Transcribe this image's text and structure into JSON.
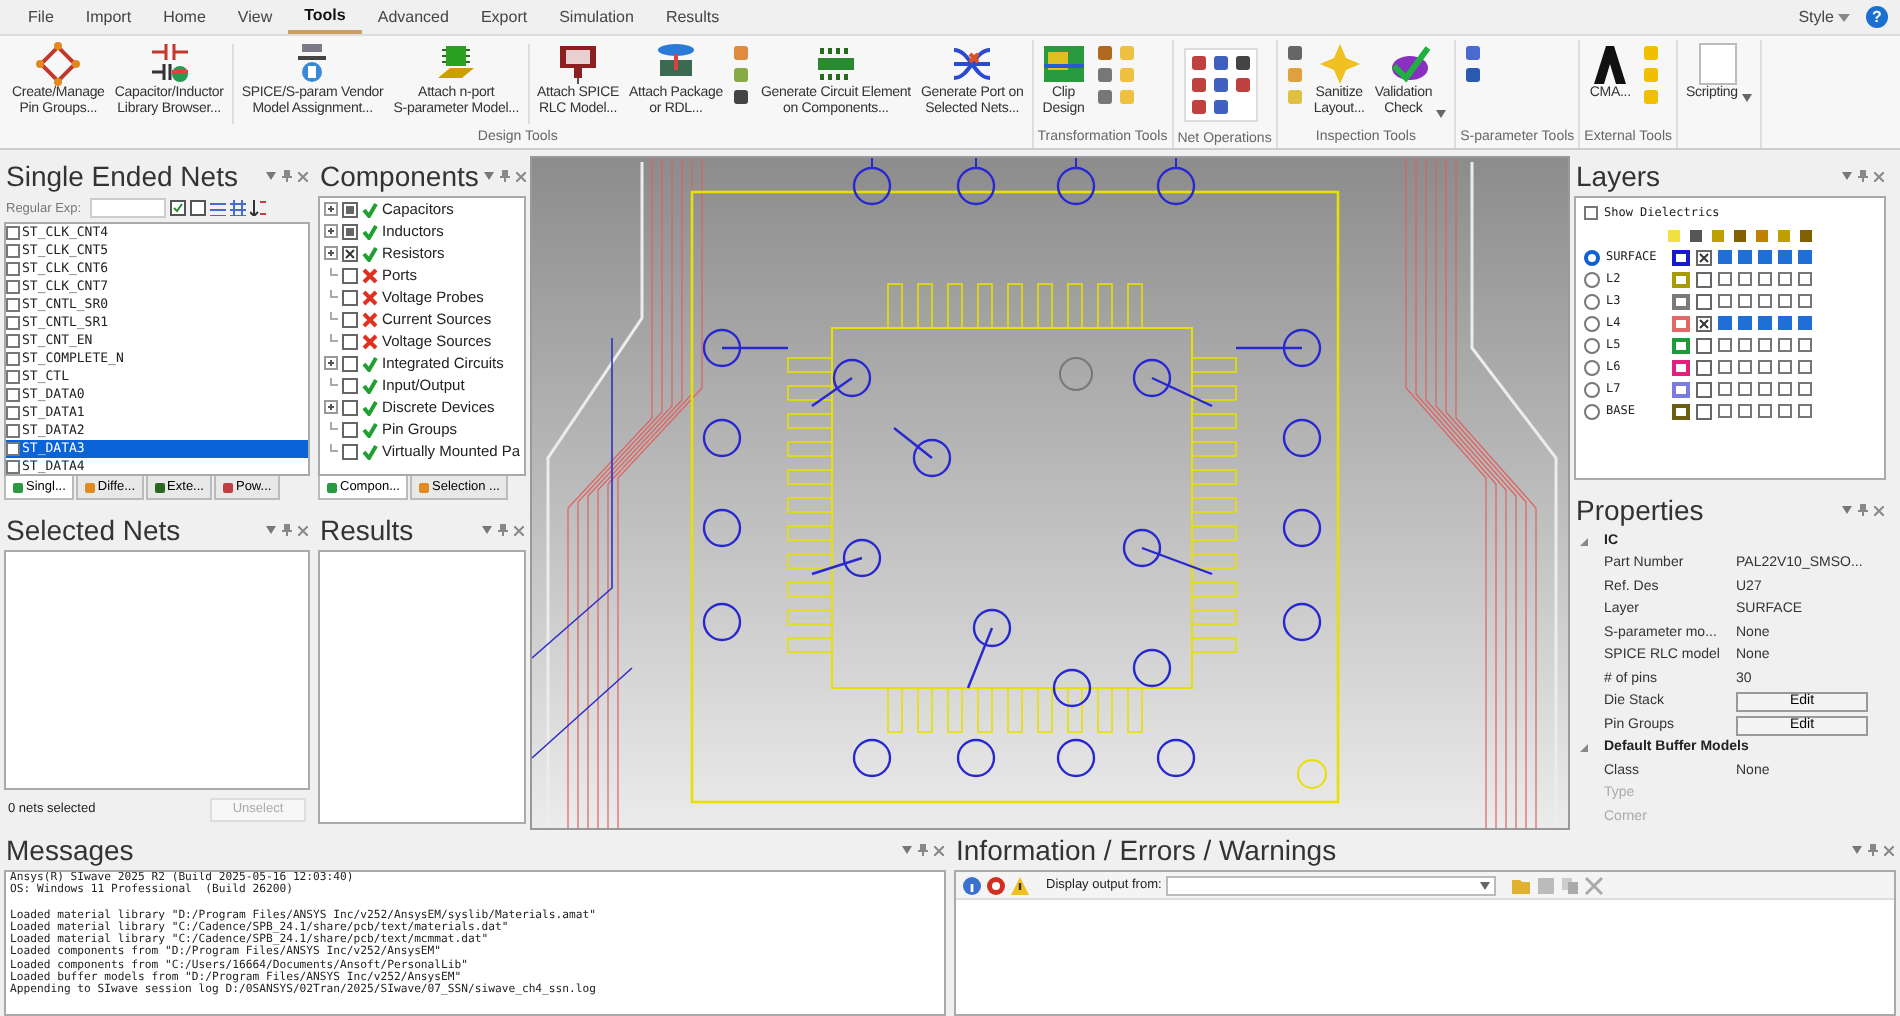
{
  "menu": [
    {
      "label": "File",
      "selected": false
    },
    {
      "label": "Import",
      "selected": false
    },
    {
      "label": "Home",
      "selected": false
    },
    {
      "label": "View",
      "selected": false
    },
    {
      "label": "Tools",
      "selected": true
    },
    {
      "label": "Advanced",
      "selected": false
    },
    {
      "label": "Export",
      "selected": false
    },
    {
      "label": "Simulation",
      "selected": false
    },
    {
      "label": "Results",
      "selected": false
    }
  ],
  "style_menu": "Style",
  "help_button": "?",
  "ribbon": [
    {
      "label": "Design Tools",
      "buttons": [
        {
          "kind": "large",
          "label": "Create/Manage\nPin Groups..."
        },
        {
          "kind": "large",
          "label": "Capacitor/Inductor\nLibrary Browser..."
        },
        {
          "kind": "separator"
        },
        {
          "kind": "large",
          "label": "SPICE/S-param Vendor\nModel Assignment..."
        },
        {
          "kind": "large",
          "label": "Attach n-port\nS-parameter Model..."
        },
        {
          "kind": "separator"
        },
        {
          "kind": "large",
          "label": "Attach SPICE\nRLC Model..."
        },
        {
          "kind": "large",
          "label": "Attach Package\nor RDL..."
        },
        {
          "kind": "icon-stack"
        },
        {
          "kind": "large",
          "label": "Generate Circuit Element\non Components..."
        },
        {
          "kind": "large",
          "label": "Generate Port on\nSelected Nets..."
        }
      ]
    },
    {
      "label": "Transformation Tools",
      "buttons": [
        {
          "kind": "large",
          "label": "Clip\nDesign"
        },
        {
          "kind": "icon-stack"
        }
      ]
    },
    {
      "label": "Net Operations",
      "buttons": [
        {
          "kind": "icon-stack"
        }
      ]
    },
    {
      "label": "Inspection Tools",
      "buttons": [
        {
          "kind": "icon-stack"
        },
        {
          "kind": "large",
          "label": "Sanitize\nLayout..."
        },
        {
          "kind": "large",
          "label": "Validation\nCheck",
          "dropdown": true
        }
      ]
    },
    {
      "label": "S-parameter Tools",
      "buttons": [
        {
          "kind": "icon-stack"
        }
      ]
    },
    {
      "label": "External Tools",
      "buttons": [
        {
          "kind": "large",
          "label": "CMA..."
        },
        {
          "kind": "icon-stack"
        }
      ]
    },
    {
      "buttons": [
        {
          "kind": "large",
          "label": "Scripting",
          "dropdown": true
        }
      ]
    }
  ],
  "single_ended_nets": {
    "title": "Single Ended Nets",
    "filter_label": "Regular Exp:",
    "items": [
      {
        "name": "ST_CLK_CNT4",
        "checked": false,
        "selected": false
      },
      {
        "name": "ST_CLK_CNT5",
        "checked": false,
        "selected": false
      },
      {
        "name": "ST_CLK_CNT6",
        "checked": false,
        "selected": false
      },
      {
        "name": "ST_CLK_CNT7",
        "checked": false,
        "selected": false
      },
      {
        "name": "ST_CNTL_SR0",
        "checked": false,
        "selected": false
      },
      {
        "name": "ST_CNTL_SR1",
        "checked": false,
        "selected": false
      },
      {
        "name": "ST_CNT_EN",
        "checked": false,
        "selected": false
      },
      {
        "name": "ST_COMPLETE_N",
        "checked": false,
        "selected": false
      },
      {
        "name": "ST_CTL",
        "checked": false,
        "selected": false
      },
      {
        "name": "ST_DATA0",
        "checked": false,
        "selected": false
      },
      {
        "name": "ST_DATA1",
        "checked": false,
        "selected": false
      },
      {
        "name": "ST_DATA2",
        "checked": false,
        "selected": false
      },
      {
        "name": "ST_DATA3",
        "checked": false,
        "selected": true
      },
      {
        "name": "ST_DATA4",
        "checked": false,
        "selected": false
      }
    ],
    "tabs": [
      {
        "label": "Singl...",
        "selected": true
      },
      {
        "label": "Diffe...",
        "selected": false
      },
      {
        "label": "Exte...",
        "selected": false
      },
      {
        "label": "Pow...",
        "selected": false
      }
    ]
  },
  "components": {
    "title": "Components",
    "items": [
      {
        "label": "Capacitors",
        "expandable": true,
        "checked": false,
        "indeterminate": true,
        "enabled": true
      },
      {
        "label": "Inductors",
        "expandable": true,
        "checked": false,
        "indeterminate": true,
        "enabled": true
      },
      {
        "label": "Resistors",
        "expandable": true,
        "checked": true,
        "indeterminate": false,
        "enabled": true
      },
      {
        "label": "Ports",
        "expandable": false,
        "checked": false,
        "indeterminate": false,
        "enabled": false
      },
      {
        "label": "Voltage Probes",
        "expandable": false,
        "checked": false,
        "indeterminate": false,
        "enabled": false
      },
      {
        "label": "Current Sources",
        "expandable": false,
        "checked": false,
        "indeterminate": false,
        "enabled": false
      },
      {
        "label": "Voltage Sources",
        "expandable": false,
        "checked": false,
        "indeterminate": false,
        "enabled": false
      },
      {
        "label": "Integrated Circuits",
        "expandable": true,
        "checked": false,
        "indeterminate": false,
        "enabled": true
      },
      {
        "label": "Input/Output",
        "expandable": false,
        "checked": false,
        "indeterminate": false,
        "enabled": true
      },
      {
        "label": "Discrete Devices",
        "expandable": true,
        "checked": false,
        "indeterminate": false,
        "enabled": true
      },
      {
        "label": "Pin Groups",
        "expandable": false,
        "checked": false,
        "indeterminate": false,
        "enabled": true
      },
      {
        "label": "Virtually Mounted Pa",
        "expandable": false,
        "checked": false,
        "indeterminate": false,
        "enabled": true
      }
    ],
    "tabs": [
      {
        "label": "Compon...",
        "selected": true
      },
      {
        "label": "Selection ...",
        "selected": false
      }
    ]
  },
  "selected_nets": {
    "title": "Selected Nets",
    "status": "0 nets selected",
    "unselect_button": {
      "label": "Unselect",
      "disabled": true
    }
  },
  "results": {
    "title": "Results"
  },
  "layers": {
    "title": "Layers",
    "show_dielectrics": {
      "label": "Show Dielectrics",
      "checked": false
    },
    "rows": [
      {
        "name": "SURFACE",
        "selected": true,
        "color": "#1818d0",
        "visible": true,
        "checks": [
          {
            "checked": true
          },
          {
            "checked": true
          },
          {
            "checked": true
          },
          {
            "checked": true
          },
          {
            "checked": true
          }
        ]
      },
      {
        "name": "L2",
        "selected": false,
        "color": "#a89a00",
        "visible": false,
        "checks": [
          {
            "checked": false
          },
          {
            "checked": false
          },
          {
            "checked": false
          },
          {
            "checked": false
          },
          {
            "checked": false
          }
        ]
      },
      {
        "name": "L3",
        "selected": false,
        "color": "#7a7a7a",
        "visible": false,
        "checks": [
          {
            "checked": false
          },
          {
            "checked": false
          },
          {
            "checked": false
          },
          {
            "checked": false
          },
          {
            "checked": false
          }
        ]
      },
      {
        "name": "L4",
        "selected": false,
        "color": "#e06868",
        "visible": true,
        "checks": [
          {
            "checked": true
          },
          {
            "checked": true
          },
          {
            "checked": true
          },
          {
            "checked": true
          },
          {
            "checked": true
          }
        ]
      },
      {
        "name": "L5",
        "selected": false,
        "color": "#1f9a3a",
        "visible": false,
        "checks": [
          {
            "checked": false
          },
          {
            "checked": false
          },
          {
            "checked": false
          },
          {
            "checked": false
          },
          {
            "checked": false
          }
        ]
      },
      {
        "name": "L6",
        "selected": false,
        "color": "#e0207a",
        "visible": false,
        "checks": [
          {
            "checked": false
          },
          {
            "checked": false
          },
          {
            "checked": false
          },
          {
            "checked": false
          },
          {
            "checked": false
          }
        ]
      },
      {
        "name": "L7",
        "selected": false,
        "color": "#7a7ae0",
        "visible": false,
        "checks": [
          {
            "checked": false
          },
          {
            "checked": false
          },
          {
            "checked": false
          },
          {
            "checked": false
          },
          {
            "checked": false
          }
        ]
      },
      {
        "name": "BASE",
        "selected": false,
        "color": "#6e5c12",
        "visible": false,
        "checks": [
          {
            "checked": false
          },
          {
            "checked": false
          },
          {
            "checked": false
          },
          {
            "checked": false
          },
          {
            "checked": false
          }
        ]
      }
    ]
  },
  "properties": {
    "title": "Properties",
    "sections": [
      {
        "label": "IC",
        "expanded": true,
        "rows": [
          {
            "kind": "text",
            "name": "Part Number",
            "value": "PAL22V10_SMSO...",
            "disabled": false
          },
          {
            "kind": "text",
            "name": "Ref. Des",
            "value": "U27",
            "disabled": false
          },
          {
            "kind": "text",
            "name": "Layer",
            "value": "SURFACE",
            "disabled": false
          },
          {
            "kind": "text",
            "name": "S-parameter mo...",
            "value": "None",
            "disabled": false
          },
          {
            "kind": "text",
            "name": "SPICE RLC model",
            "value": "None",
            "disabled": false
          },
          {
            "kind": "text",
            "name": "# of pins",
            "value": "30",
            "disabled": false
          },
          {
            "kind": "button",
            "name": "Die Stack",
            "value": "Edit",
            "disabled": false
          },
          {
            "kind": "button",
            "name": "Pin Groups",
            "value": "Edit",
            "disabled": false
          }
        ]
      },
      {
        "label": "Default Buffer Models",
        "expanded": true,
        "rows": [
          {
            "kind": "text",
            "name": "Class",
            "value": "None",
            "disabled": false
          },
          {
            "kind": "text",
            "name": "Type",
            "disabled": true
          },
          {
            "kind": "text",
            "name": "Corner",
            "disabled": true
          }
        ]
      }
    ]
  },
  "messages": {
    "title": "Messages",
    "groups": [
      [
        "Ansys(R) SIwave 2025 R2 (Build 2025-05-16 12:03:40)",
        "OS: Windows 11 Professional  (Build 26200)"
      ],
      [
        "Loaded material library \"D:/Program Files/ANSYS Inc/v252/AnsysEM/syslib/Materials.amat\"",
        "Loaded material library \"C:/Cadence/SPB_24.1/share/pcb/text/materials.dat\"",
        "Loaded material library \"C:/Cadence/SPB_24.1/share/pcb/text/mcmmat.dat\"",
        "Loaded components from \"D:/Program Files/ANSYS Inc/v252/AnsysEM\"",
        "Loaded components from \"C:/Users/16664/Documents/Ansoft/PersonalLib\"",
        "Loaded buffer models from \"D:/Program Files/ANSYS Inc/v252/AnsysEM\"",
        "Appending to SIwave session log D:/0SANSYS/02Tran/2025/SIwave/07_SSN/siwave_ch4_ssn.log"
      ]
    ]
  },
  "info": {
    "title": "Information / Errors / Warnings",
    "filter_label": "Display output from:"
  }
}
